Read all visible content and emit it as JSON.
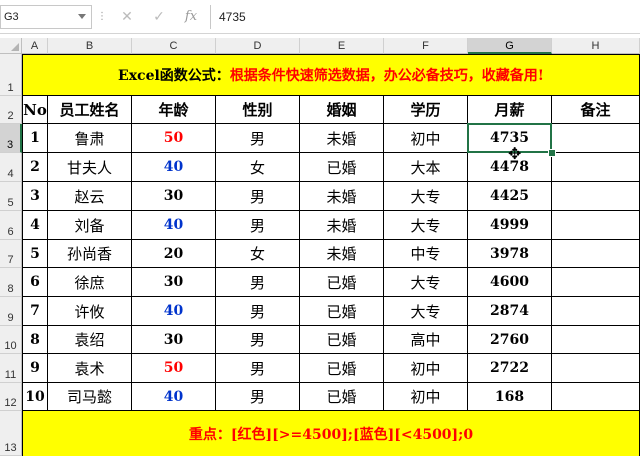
{
  "formula_bar": {
    "name_box": "G3",
    "cancel_icon": "close-icon",
    "enter_icon": "check-icon",
    "function_icon": "fx",
    "formula": "4735"
  },
  "columns": [
    "A",
    "B",
    "C",
    "D",
    "E",
    "F",
    "G",
    "H"
  ],
  "selected_column": "G",
  "rows": [
    "1",
    "2",
    "3",
    "4",
    "5",
    "6",
    "7",
    "8",
    "9",
    "10",
    "11",
    "12",
    "13"
  ],
  "selected_row": "3",
  "title": {
    "prefix": "Excel函数公式：",
    "text": "根据条件快速筛选数据，办公必备技巧，收藏备用!"
  },
  "table": {
    "headers": [
      "No",
      "员工姓名",
      "年龄",
      "性别",
      "婚姻",
      "学历",
      "月薪",
      "备注"
    ],
    "rows": [
      {
        "no": "1",
        "name": "鲁肃",
        "age": "50",
        "age_color": "red",
        "gender": "男",
        "marriage": "未婚",
        "edu": "初中",
        "salary": "4735",
        "note": ""
      },
      {
        "no": "2",
        "name": "甘夫人",
        "age": "40",
        "age_color": "blue",
        "gender": "女",
        "marriage": "已婚",
        "edu": "大本",
        "salary": "4478",
        "note": ""
      },
      {
        "no": "3",
        "name": "赵云",
        "age": "30",
        "age_color": "black",
        "gender": "男",
        "marriage": "未婚",
        "edu": "大专",
        "salary": "4425",
        "note": ""
      },
      {
        "no": "4",
        "name": "刘备",
        "age": "40",
        "age_color": "blue",
        "gender": "男",
        "marriage": "未婚",
        "edu": "大专",
        "salary": "4999",
        "note": ""
      },
      {
        "no": "5",
        "name": "孙尚香",
        "age": "20",
        "age_color": "black",
        "gender": "女",
        "marriage": "未婚",
        "edu": "中专",
        "salary": "3978",
        "note": ""
      },
      {
        "no": "6",
        "name": "徐庶",
        "age": "30",
        "age_color": "black",
        "gender": "男",
        "marriage": "已婚",
        "edu": "大专",
        "salary": "4600",
        "note": ""
      },
      {
        "no": "7",
        "name": "许攸",
        "age": "40",
        "age_color": "blue",
        "gender": "男",
        "marriage": "已婚",
        "edu": "大专",
        "salary": "2874",
        "note": ""
      },
      {
        "no": "8",
        "name": "袁绍",
        "age": "30",
        "age_color": "black",
        "gender": "男",
        "marriage": "已婚",
        "edu": "高中",
        "salary": "2760",
        "note": ""
      },
      {
        "no": "9",
        "name": "袁术",
        "age": "50",
        "age_color": "red",
        "gender": "男",
        "marriage": "已婚",
        "edu": "初中",
        "salary": "2722",
        "note": ""
      },
      {
        "no": "10",
        "name": "司马懿",
        "age": "40",
        "age_color": "blue",
        "gender": "男",
        "marriage": "已婚",
        "edu": "初中",
        "salary": "168",
        "note": ""
      }
    ]
  },
  "footer": {
    "text": "重点：[红色][>=4500];[蓝色][<4500];0"
  },
  "colors": {
    "banner": "#ffff00",
    "red": "#ff0000",
    "blue": "#0033cc",
    "selection": "#217346"
  }
}
